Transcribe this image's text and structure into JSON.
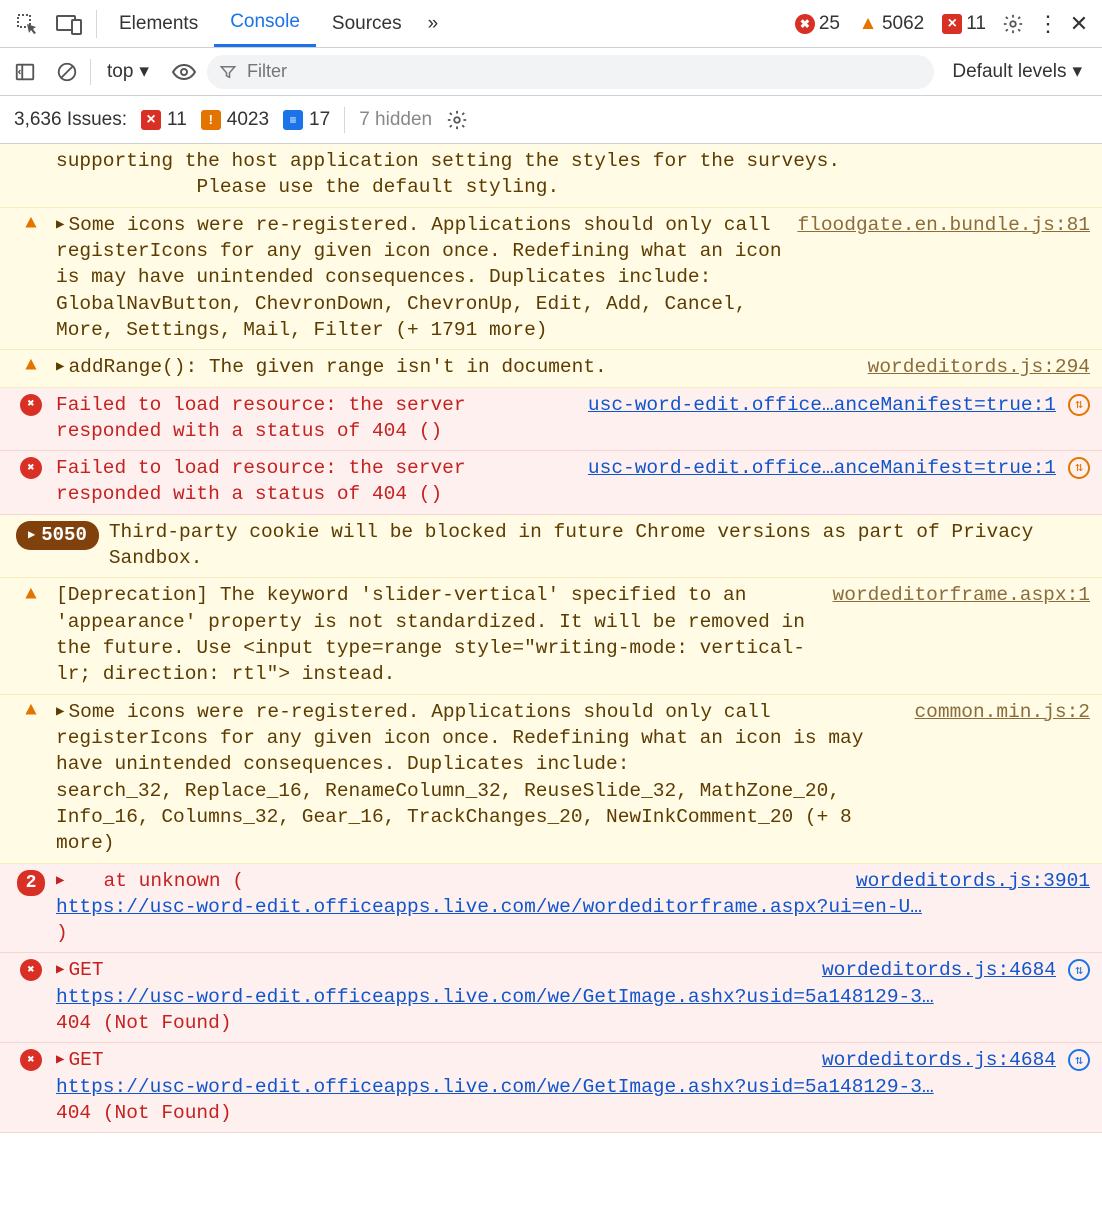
{
  "tabs": {
    "elements": "Elements",
    "console": "Console",
    "sources": "Sources",
    "more_glyph": "»"
  },
  "header_counts": {
    "errors": "25",
    "warnings": "5062",
    "blocked": "11"
  },
  "filterbar": {
    "context": "top",
    "filter_placeholder": "Filter",
    "levels_label": "Default levels"
  },
  "issuesbar": {
    "issues_label": "3,636 Issues:",
    "red": "11",
    "orange": "4023",
    "blue": "17",
    "hidden": "7 hidden"
  },
  "messages": [
    {
      "type": "warn",
      "partial": true,
      "text": "supporting the host application setting the styles for the surveys.\n            Please use the default styling."
    },
    {
      "type": "warn",
      "disclosure": true,
      "text": "Some icons were re-registered. Applications should only call registerIcons for any given icon once. Redefining what an icon is may have unintended consequences. Duplicates include: \nGlobalNavButton, ChevronDown, ChevronUp, Edit, Add, Cancel, More, Settings, Mail, Filter (+ 1791 more)",
      "src": "floodgate.en.bundle.js:81"
    },
    {
      "type": "warn",
      "disclosure": true,
      "text": "addRange(): The given range isn't in document.",
      "src": "wordeditords.js:294"
    },
    {
      "type": "err",
      "text": "Failed to load resource: the server responded with a status of 404 ()",
      "src": "usc-word-edit.office…anceManifest=true:1",
      "srcicon": "orange"
    },
    {
      "type": "err",
      "text": "Failed to load resource: the server responded with a status of 404 ()",
      "src": "usc-word-edit.office…anceManifest=true:1",
      "srcicon": "orange"
    },
    {
      "type": "warn",
      "bigcount": "5050",
      "text": "Third-party cookie will be blocked in future Chrome versions as part of Privacy Sandbox."
    },
    {
      "type": "warn",
      "text": "[Deprecation] The keyword 'slider-vertical' specified to an 'appearance' property is not standardized. It will be removed in the future. Use <input type=range style=\"writing-mode: vertical-lr; direction: rtl\"> instead.",
      "src": "wordeditorframe.aspx:1"
    },
    {
      "type": "warn",
      "disclosure": true,
      "text": "Some icons were re-registered. Applications should only call registerIcons for any given icon once. Redefining what an icon is may have unintended consequences. Duplicates include: \nsearch_32, Replace_16, RenameColumn_32, ReuseSlide_32, MathZone_20, Info_16, Columns_32, Gear_16, TrackChanges_20, NewInkComment_20 (+ 8 more)",
      "src": "common.min.js:2"
    },
    {
      "type": "err",
      "count": "2",
      "disclosure": true,
      "pre": "   at unknown (",
      "link": "https://usc-word-edit.officeapps.live.com/we/wordeditorframe.aspx?ui=en-U…",
      "post": ")",
      "src": "wordeditords.js:3901"
    },
    {
      "type": "err",
      "disclosure": true,
      "pre": "GET ",
      "link": "https://usc-word-edit.officeapps.live.com/we/GetImage.ashx?usid=5a148129-3…",
      "post": " 404 (Not Found)",
      "src": "wordeditords.js:4684",
      "srcicon": "blue"
    },
    {
      "type": "err",
      "disclosure": true,
      "pre": "GET ",
      "link": "https://usc-word-edit.officeapps.live.com/we/GetImage.ashx?usid=5a148129-3…",
      "post": " 404 (Not Found)",
      "src": "wordeditords.js:4684",
      "srcicon": "blue"
    }
  ]
}
